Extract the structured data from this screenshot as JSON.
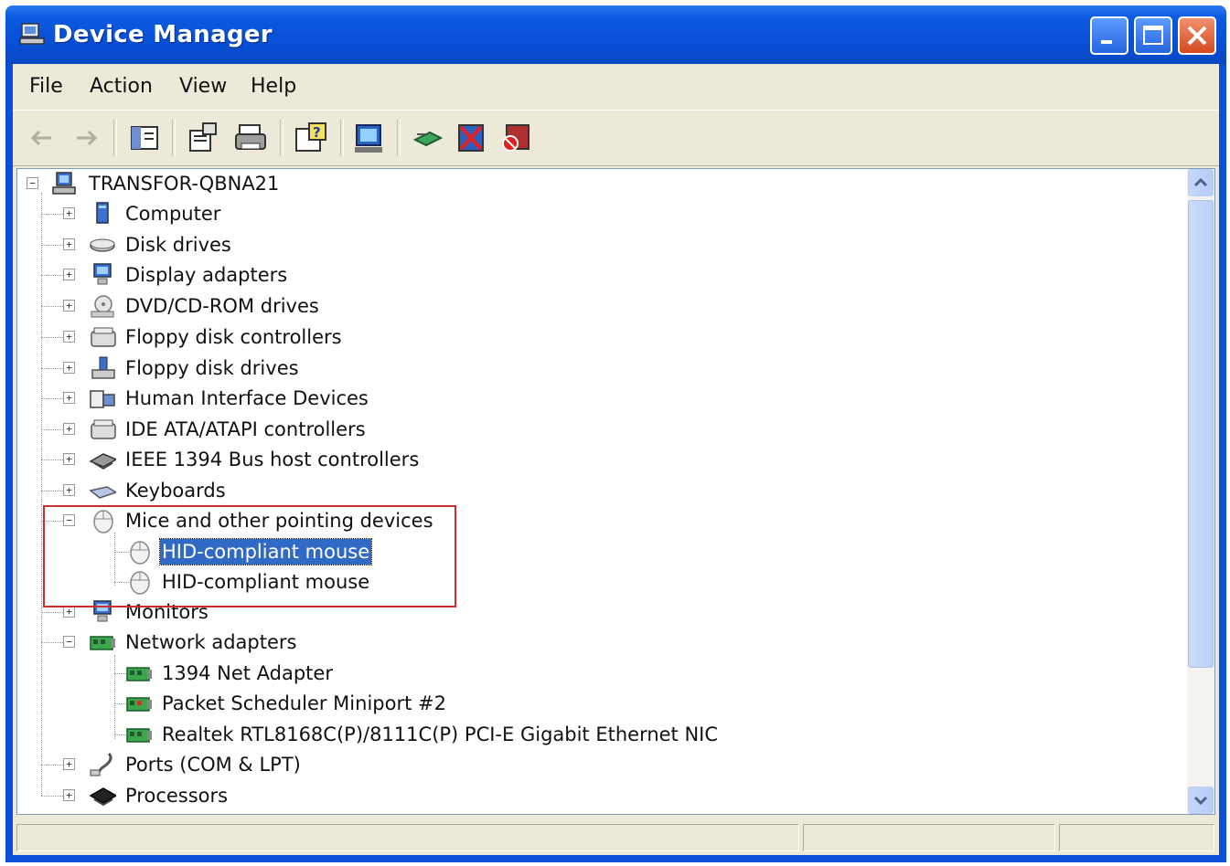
{
  "window": {
    "title": "Device Manager"
  },
  "menu": {
    "items": [
      "File",
      "Action",
      "View",
      "Help"
    ]
  },
  "toolbar": {
    "buttons": [
      {
        "icon": "back-arrow-icon"
      },
      {
        "icon": "forward-arrow-icon"
      },
      {
        "icon": "show-hide-console-tree-icon"
      },
      {
        "icon": "properties-icon"
      },
      {
        "icon": "print-icon"
      },
      {
        "icon": "help-icon"
      },
      {
        "icon": "scan-hardware-changes-icon"
      },
      {
        "icon": "update-driver-icon"
      },
      {
        "icon": "uninstall-icon"
      },
      {
        "icon": "disable-icon"
      }
    ]
  },
  "tree": {
    "root": "TRANSFOR-QBNA21",
    "categories": [
      {
        "label": "Computer",
        "icon": "computer-icon",
        "expanded": false
      },
      {
        "label": "Disk drives",
        "icon": "disk-drive-icon",
        "expanded": false
      },
      {
        "label": "Display adapters",
        "icon": "display-adapter-icon",
        "expanded": false
      },
      {
        "label": "DVD/CD-ROM drives",
        "icon": "cdrom-icon",
        "expanded": false
      },
      {
        "label": "Floppy disk controllers",
        "icon": "floppy-controller-icon",
        "expanded": false
      },
      {
        "label": "Floppy disk drives",
        "icon": "floppy-drive-icon",
        "expanded": false
      },
      {
        "label": "Human Interface Devices",
        "icon": "hid-icon",
        "expanded": false
      },
      {
        "label": "IDE ATA/ATAPI controllers",
        "icon": "ide-controller-icon",
        "expanded": false
      },
      {
        "label": "IEEE 1394 Bus host controllers",
        "icon": "ieee1394-icon",
        "expanded": false
      },
      {
        "label": "Keyboards",
        "icon": "keyboard-icon",
        "expanded": false
      },
      {
        "label": "Mice and other pointing devices",
        "icon": "mouse-icon",
        "expanded": true,
        "children": [
          {
            "label": "HID-compliant mouse",
            "icon": "mouse-icon",
            "selected": true
          },
          {
            "label": "HID-compliant mouse",
            "icon": "mouse-icon",
            "selected": false
          }
        ]
      },
      {
        "label": "Monitors",
        "icon": "monitor-icon",
        "expanded": false
      },
      {
        "label": "Network adapters",
        "icon": "network-card-icon",
        "expanded": true,
        "children": [
          {
            "label": "1394 Net Adapter",
            "icon": "network-card-icon"
          },
          {
            "label": "Packet Scheduler Miniport #2",
            "icon": "network-card-icon"
          },
          {
            "label": "Realtek RTL8168C(P)/8111C(P) PCI-E Gigabit Ethernet NIC",
            "icon": "network-card-icon"
          }
        ]
      },
      {
        "label": "Ports (COM & LPT)",
        "icon": "port-icon",
        "expanded": false
      },
      {
        "label": "Processors",
        "icon": "processor-icon",
        "expanded": false
      }
    ]
  },
  "colors": {
    "titlebar": "#0a4fd6",
    "selection": "#316ac5",
    "highlight_box": "#c83030"
  }
}
